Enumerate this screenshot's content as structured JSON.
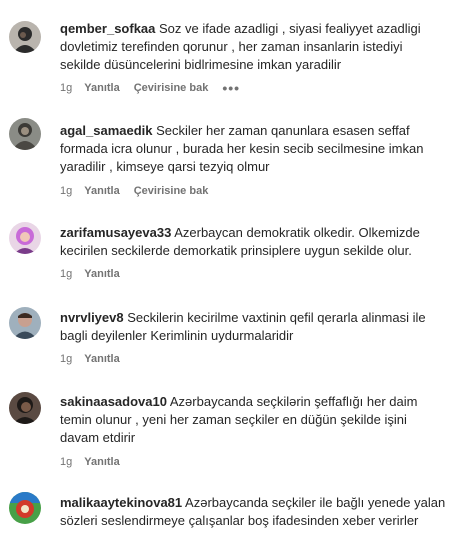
{
  "comments": [
    {
      "username": "qember_sofkaa",
      "text": "Soz ve ifade azadligi , siyasi fealiyyet azadligi dovletimiz terefinden qorunur , her zaman insanlarin istediyi sekilde düsüncelerini bidlrimesine imkan yaradilir",
      "time": "1g",
      "reply": "Yanıtla",
      "translate": "Çevirisine bak",
      "more": "•••",
      "avatar_colors": [
        "#2b2b2b",
        "#6b5a4e"
      ]
    },
    {
      "username": "agal_samaedik",
      "text": "Seckiler her zaman qanunlara esasen seffaf formada icra olunur , burada her kesin secib secilmesine imkan yaradilir , kimseye qarsi tezyiq olmur",
      "time": "1g",
      "reply": "Yanıtla",
      "translate": "Çevirisine bak",
      "avatar_colors": [
        "#3b3a36",
        "#9a8f80"
      ]
    },
    {
      "username": "zarifamusayeva33",
      "text": "Azerbaycan demokratik olkedir. Olkemizde kecirilen seckilerde demorkatik prinsiplere uygun sekilde olur.",
      "time": "1g",
      "reply": "Yanıtla",
      "avatar_colors": [
        "#c86bd8",
        "#f0c8b8"
      ]
    },
    {
      "username": "nvrvliyev8",
      "text": "Seckilerin kecirilme vaxtinin qefil qerarla alinmasi ile bagli deyilenler Kerimlinin uydurmalaridir",
      "time": "1g",
      "reply": "Yanıtla",
      "avatar_colors": [
        "#3a4a5a",
        "#c8a090"
      ]
    },
    {
      "username": "sakinaasadova10",
      "text": "Azərbaycanda seçkilərin şeffaflığı her daim temin olunur , yeni her zaman seçkiler en düğün şekilde işini davam etdirir",
      "time": "1g",
      "reply": "Yanıtla",
      "avatar_colors": [
        "#1e1a18",
        "#7a5a48"
      ]
    },
    {
      "username": "malikaaytekinova81",
      "text": "Azərbaycanda seçkiler ile bağlı yenede yalan sözleri seslendirmeye çalışanlar boş ifadesinden xeber verirler",
      "time": "",
      "reply": "",
      "avatar_colors": [
        "#d23a2a",
        "#48a048"
      ]
    }
  ]
}
